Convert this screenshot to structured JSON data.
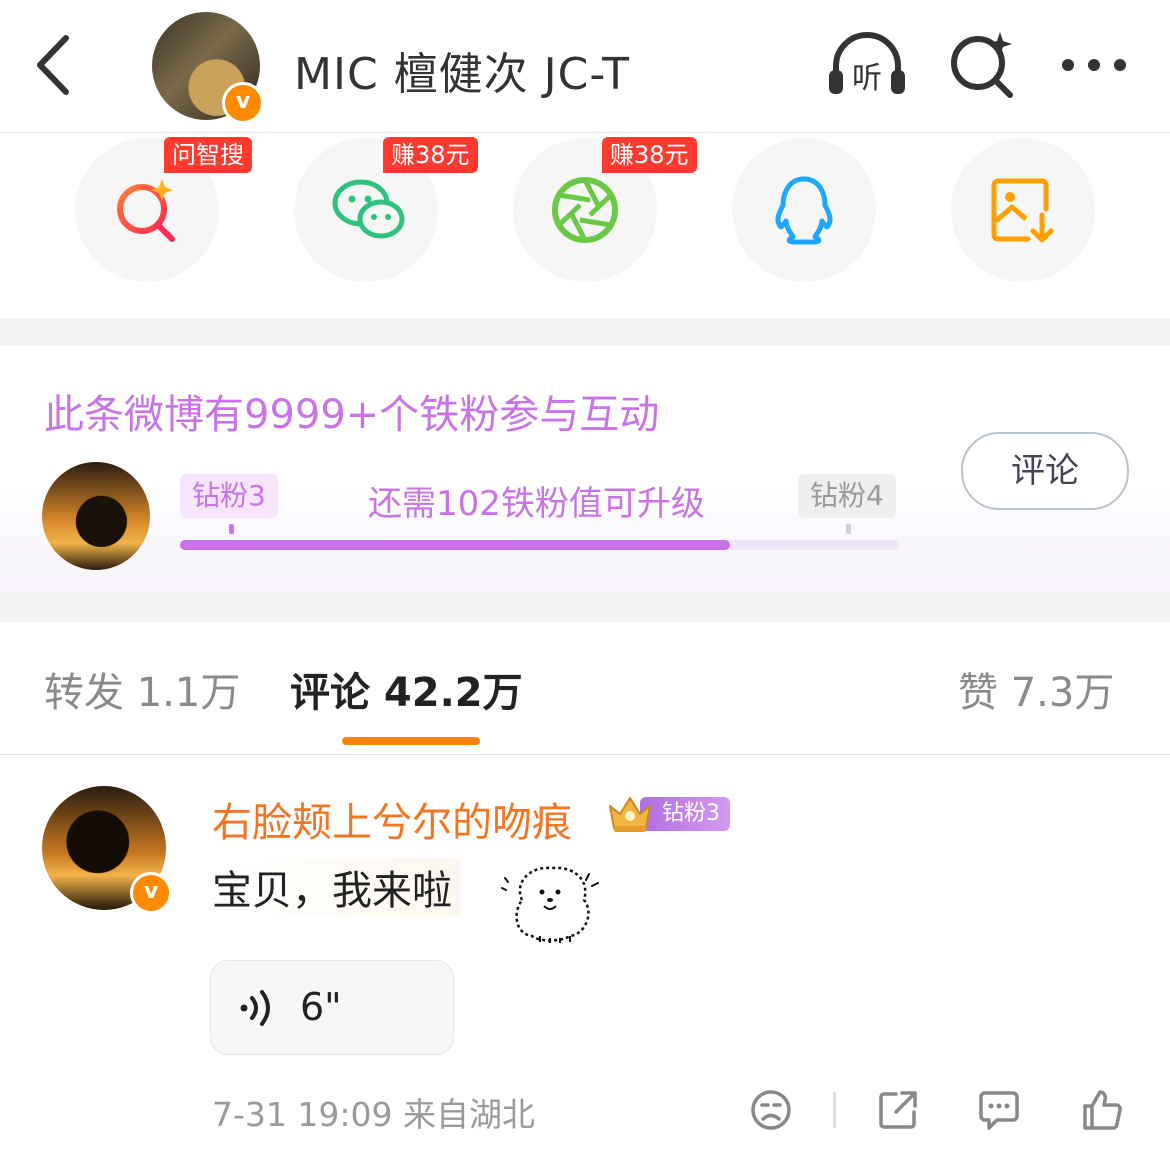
{
  "header": {
    "title": "MIC 檀健次 JC-T",
    "listen_label": "听"
  },
  "share": {
    "items": [
      {
        "name": "问智搜",
        "tag": "问智搜"
      },
      {
        "name": "WeChat",
        "tag": "赚38元"
      },
      {
        "name": "Moments",
        "tag": "赚38元"
      },
      {
        "name": "QQ",
        "tag": ""
      },
      {
        "name": "Save image",
        "tag": ""
      }
    ]
  },
  "fans": {
    "title": "此条微博有9999+个铁粉参与互动",
    "current_level": "钻粉3",
    "next_level": "钻粉4",
    "progress_text": "还需102铁粉值可升级",
    "progress_fraction": 0.764,
    "comment_button": "评论"
  },
  "tabs": {
    "repost": "转发 1.1万",
    "comments": "评论 42.2万",
    "likes": "赞 7.3万"
  },
  "comment": {
    "username": "右脸颊上兮尔的吻痕",
    "fan_badge": "钻粉3",
    "text": "宝贝，我来啦",
    "voice_duration": "6\"",
    "meta": "7-31 19:09  来自湖北"
  },
  "colors": {
    "accent_orange": "#ff8200",
    "fan_purple": "#c873e8",
    "username_orange": "#f37521",
    "tag_red": "#ff3b30"
  }
}
